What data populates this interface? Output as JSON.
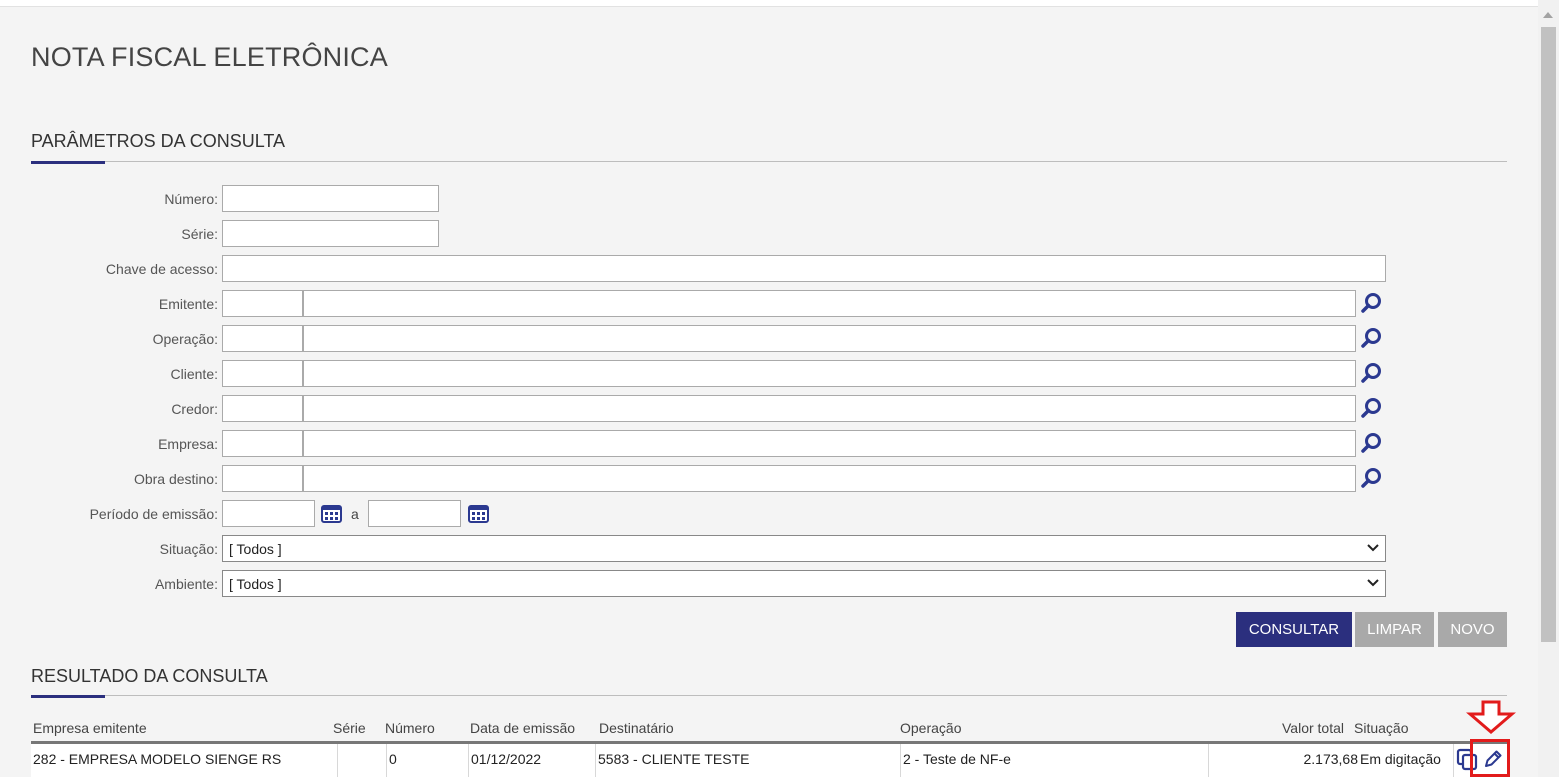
{
  "page": {
    "title": "NOTA FISCAL ELETRÔNICA"
  },
  "params": {
    "section_title": "PARÂMETROS DA CONSULTA",
    "fields": {
      "numero": {
        "label": "Número:",
        "value": ""
      },
      "serie": {
        "label": "Série:",
        "value": ""
      },
      "chave": {
        "label": "Chave de acesso:",
        "value": ""
      },
      "emitente": {
        "label": "Emitente:",
        "code": "",
        "desc": ""
      },
      "operacao": {
        "label": "Operação:",
        "code": "",
        "desc": ""
      },
      "cliente": {
        "label": "Cliente:",
        "code": "",
        "desc": ""
      },
      "credor": {
        "label": "Credor:",
        "code": "",
        "desc": ""
      },
      "empresa": {
        "label": "Empresa:",
        "code": "",
        "desc": ""
      },
      "obra_destino": {
        "label": "Obra destino:",
        "code": "",
        "desc": ""
      },
      "periodo": {
        "label": "Período de emissão:",
        "from": "",
        "separator": "a",
        "to": ""
      },
      "situacao": {
        "label": "Situação:",
        "selected": "[ Todos ]"
      },
      "ambiente": {
        "label": "Ambiente:",
        "selected": "[ Todos ]"
      }
    },
    "buttons": {
      "consultar": "CONSULTAR",
      "limpar": "LIMPAR",
      "novo": "NOVO"
    }
  },
  "results": {
    "section_title": "RESULTADO DA CONSULTA",
    "columns": {
      "empresa": "Empresa emitente",
      "serie": "Série",
      "numero": "Número",
      "data": "Data de emissão",
      "destinatario": "Destinatário",
      "operacao": "Operação",
      "valor": "Valor total",
      "situacao": "Situação"
    },
    "rows": [
      {
        "empresa": "282 - EMPRESA MODELO SIENGE RS",
        "serie": "",
        "numero": "0",
        "data": "01/12/2022",
        "destinatario": "5583 - CLIENTE TESTE",
        "operacao": "2 - Teste de NF-e",
        "valor": "2.173,68",
        "situacao": "Em digitação"
      }
    ]
  },
  "icons": {
    "search": "magnifier-icon",
    "calendar": "calendar-icon",
    "copy": "copy-icon",
    "edit": "pencil-icon",
    "annotation_arrow": "down-arrow-icon"
  },
  "colors": {
    "primary": "#2b2f7e",
    "secondary_button": "#a9a9a9",
    "annotation": "#e21b1b",
    "icon_blue": "#2b3990"
  }
}
